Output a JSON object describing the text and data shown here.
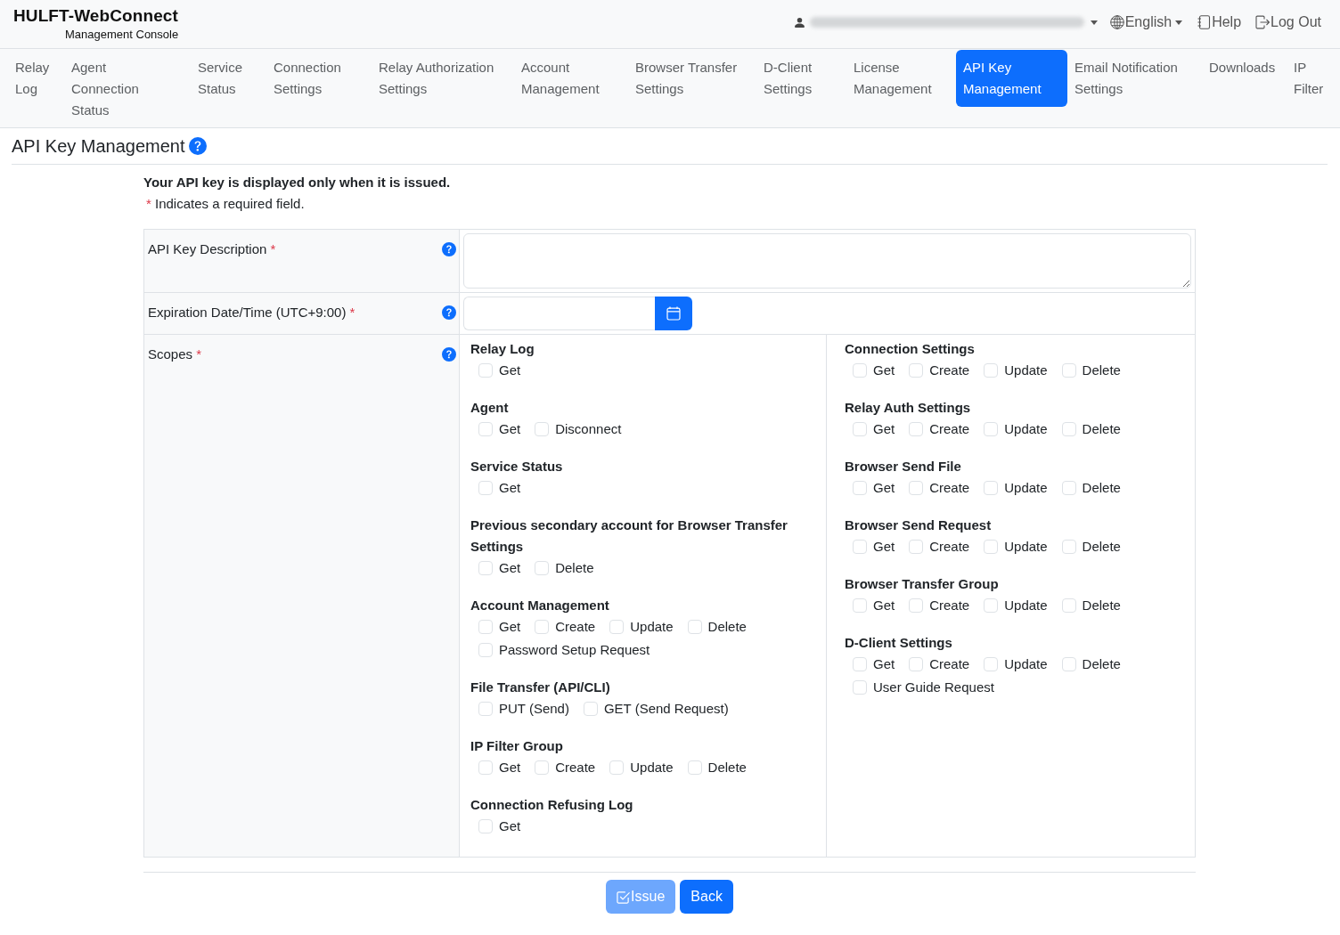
{
  "header": {
    "logo": "HULFT-WebConnect",
    "subtitle": "Management Console",
    "language": {
      "label": "English"
    },
    "help": {
      "label": "Help"
    },
    "logout": {
      "label": "Log Out"
    }
  },
  "nav": [
    {
      "label": "Relay Log",
      "selected": false
    },
    {
      "label": "Agent Connection Status",
      "selected": false
    },
    {
      "label": "Service Status",
      "selected": false
    },
    {
      "label": "Connection Settings",
      "selected": false
    },
    {
      "label": "Relay Authorization Settings",
      "selected": false
    },
    {
      "label": "Account Management",
      "selected": false
    },
    {
      "label": "Browser Transfer Settings",
      "selected": false
    },
    {
      "label": "D-Client Settings",
      "selected": false
    },
    {
      "label": "License Management",
      "selected": false
    },
    {
      "label": "API Key Management",
      "selected": true
    },
    {
      "label": "Email Notification Settings",
      "selected": false
    },
    {
      "label": "Downloads",
      "selected": false
    },
    {
      "label": "IP Filter",
      "selected": false
    }
  ],
  "page": {
    "title": "API Key Management",
    "help": true,
    "notice": "Your API key is displayed only when it is issued.",
    "required_note": {
      "mark": "*",
      "text": "Indicates a required field."
    }
  },
  "form": {
    "fields": [
      {
        "kind": "textarea",
        "label": "API Key Description",
        "mark": "*",
        "help": true
      },
      {
        "kind": "datetime",
        "label": "Expiration Date/Time (UTC+9:00)",
        "mark": "*",
        "help": true
      },
      {
        "kind": "scopes",
        "label": "Scopes",
        "mark": "*",
        "help": true,
        "columns": [
          {
            "groups": [
              {
                "title": "Relay Log",
                "options": [
                  {
                    "label": "Get",
                    "checked": false
                  }
                ]
              },
              {
                "title": "Agent",
                "options": [
                  {
                    "label": "Get",
                    "checked": false
                  },
                  {
                    "label": "Disconnect",
                    "checked": false
                  }
                ]
              },
              {
                "title": "Service Status",
                "options": [
                  {
                    "label": "Get",
                    "checked": false
                  }
                ]
              },
              {
                "title": "Previous secondary account for Browser Transfer Settings",
                "options": [
                  {
                    "label": "Get",
                    "checked": false
                  },
                  {
                    "label": "Delete",
                    "checked": false
                  }
                ]
              },
              {
                "title": "Account Management",
                "options": [
                  {
                    "label": "Get",
                    "checked": false
                  },
                  {
                    "label": "Create",
                    "checked": false
                  },
                  {
                    "label": "Update",
                    "checked": false
                  },
                  {
                    "label": "Delete",
                    "checked": false
                  },
                  {
                    "label": "Password Setup Request",
                    "checked": false
                  }
                ]
              },
              {
                "title": "File Transfer (API/CLI)",
                "options": [
                  {
                    "label": "PUT (Send)",
                    "checked": false
                  },
                  {
                    "label": "GET (Send Request)",
                    "checked": false
                  }
                ]
              },
              {
                "title": "IP Filter Group",
                "options": [
                  {
                    "label": "Get",
                    "checked": false
                  },
                  {
                    "label": "Create",
                    "checked": false
                  },
                  {
                    "label": "Update",
                    "checked": false
                  },
                  {
                    "label": "Delete",
                    "checked": false
                  }
                ]
              },
              {
                "title": "Connection Refusing Log",
                "options": [
                  {
                    "label": "Get",
                    "checked": false
                  }
                ]
              }
            ]
          },
          {
            "groups": [
              {
                "title": "Connection Settings",
                "options": [
                  {
                    "label": "Get",
                    "checked": false
                  },
                  {
                    "label": "Create",
                    "checked": false
                  },
                  {
                    "label": "Update",
                    "checked": false
                  },
                  {
                    "label": "Delete",
                    "checked": false
                  }
                ]
              },
              {
                "title": "Relay Auth Settings",
                "options": [
                  {
                    "label": "Get",
                    "checked": false
                  },
                  {
                    "label": "Create",
                    "checked": false
                  },
                  {
                    "label": "Update",
                    "checked": false
                  },
                  {
                    "label": "Delete",
                    "checked": false
                  }
                ]
              },
              {
                "title": "Browser Send File",
                "options": [
                  {
                    "label": "Get",
                    "checked": false
                  },
                  {
                    "label": "Create",
                    "checked": false
                  },
                  {
                    "label": "Update",
                    "checked": false
                  },
                  {
                    "label": "Delete",
                    "checked": false
                  }
                ]
              },
              {
                "title": "Browser Send Request",
                "options": [
                  {
                    "label": "Get",
                    "checked": false
                  },
                  {
                    "label": "Create",
                    "checked": false
                  },
                  {
                    "label": "Update",
                    "checked": false
                  },
                  {
                    "label": "Delete",
                    "checked": false
                  }
                ]
              },
              {
                "title": "Browser Transfer Group",
                "options": [
                  {
                    "label": "Get",
                    "checked": false
                  },
                  {
                    "label": "Create",
                    "checked": false
                  },
                  {
                    "label": "Update",
                    "checked": false
                  },
                  {
                    "label": "Delete",
                    "checked": false
                  }
                ]
              },
              {
                "title": "D-Client Settings",
                "options": [
                  {
                    "label": "Get",
                    "checked": false
                  },
                  {
                    "label": "Create",
                    "checked": false
                  },
                  {
                    "label": "Update",
                    "checked": false
                  },
                  {
                    "label": "Delete",
                    "checked": false
                  },
                  {
                    "label": "User Guide Request",
                    "checked": false
                  }
                ]
              }
            ]
          }
        ]
      }
    ]
  },
  "buttons": [
    {
      "kind": "issue",
      "label": "Issue",
      "disabled": true
    },
    {
      "kind": "back",
      "label": "Back",
      "disabled": false
    }
  ]
}
